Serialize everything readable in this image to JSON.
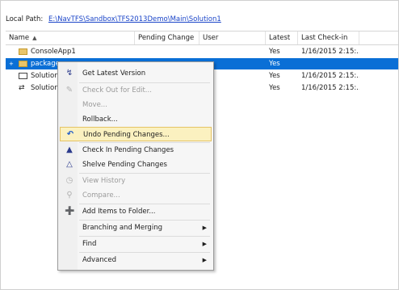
{
  "local_path": {
    "label": "Local Path:",
    "value": "E:\\NavTFS\\Sandbox\\TFS2013Demo\\Main\\Solution1"
  },
  "columns": [
    "Name",
    "Pending Change",
    "User",
    "Latest",
    "Last Check-in"
  ],
  "rows": [
    {
      "name": "ConsoleApp1",
      "latest": "Yes",
      "checkin": "1/16/2015 2:15:..."
    },
    {
      "name": "package",
      "latest": "Yes",
      "checkin": ""
    },
    {
      "name": "Solution",
      "latest": "Yes",
      "checkin": "1/16/2015 2:15:..."
    },
    {
      "name": "Solution",
      "latest": "Yes",
      "checkin": "1/16/2015 2:15:..."
    }
  ],
  "menu": {
    "items": [
      {
        "label": "Get Latest Version",
        "icon": "get-latest-icon"
      },
      {
        "label": "Check Out for Edit...",
        "icon": "check-out-icon"
      },
      {
        "label": "Move..."
      },
      {
        "label": "Rollback..."
      },
      {
        "label": "Undo Pending Changes...",
        "icon": "undo-icon"
      },
      {
        "label": "Check In Pending Changes",
        "icon": "check-in-icon"
      },
      {
        "label": "Shelve Pending Changes",
        "icon": "shelve-icon"
      },
      {
        "label": "View History",
        "icon": "history-icon"
      },
      {
        "label": "Compare...",
        "icon": "compare-icon"
      },
      {
        "label": "Add Items to Folder...",
        "icon": "add-items-icon"
      },
      {
        "label": "Branching and Merging"
      },
      {
        "label": "Find"
      },
      {
        "label": "Advanced"
      }
    ]
  },
  "colors": {
    "selection": "#0a6fd6",
    "highlight": "#fbf1c0"
  }
}
